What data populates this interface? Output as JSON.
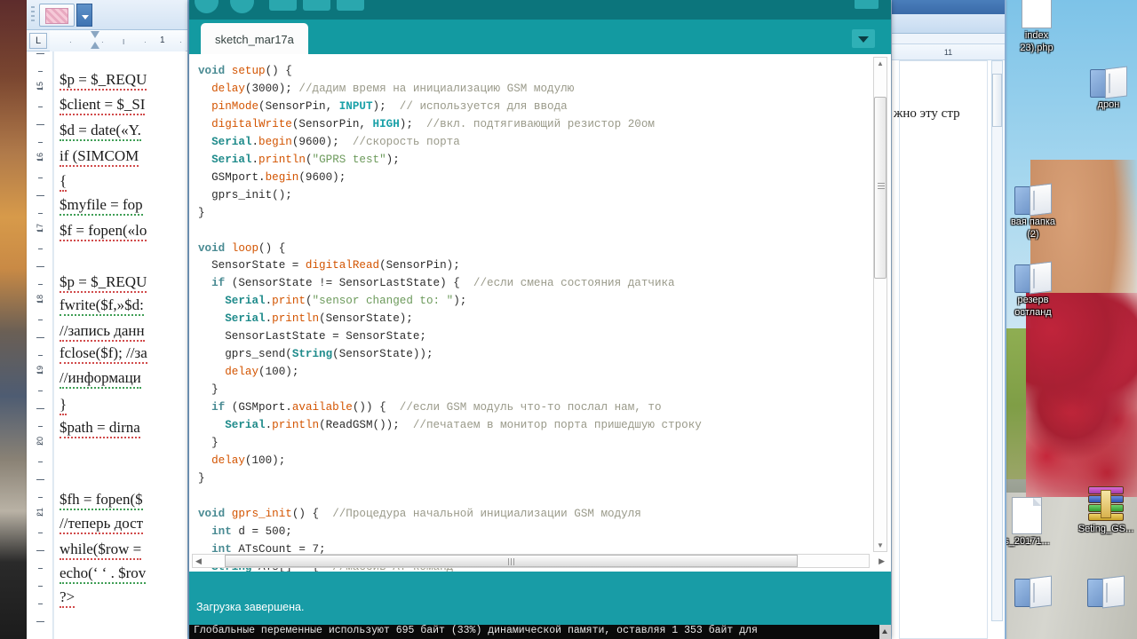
{
  "desktop": {
    "icons": [
      {
        "name": "index(23).php",
        "label_line1": "index",
        "label_line2": "23).php",
        "type": "doc"
      },
      {
        "name": "дрон",
        "label_line1": "дрон",
        "label_line2": "",
        "type": "folder"
      },
      {
        "name": "Новая папка (2)",
        "label_line1": "вая папка",
        "label_line2": "(2)",
        "type": "folder"
      },
      {
        "name": "резерв Хостланд",
        "label_line1": "резерв",
        "label_line2": "остланд",
        "type": "folder"
      },
      {
        "name": "s_20171...",
        "label_line1": "s_20171...",
        "label_line2": "",
        "type": "doc"
      },
      {
        "name": "Seting_GS...",
        "label_line1": "Seting_GS...",
        "label_line2": "",
        "type": "rar",
        "rar_letter": "R"
      }
    ]
  },
  "word_front": {
    "ruler": {
      "tab_selector": "L",
      "marks": [
        "·",
        "·",
        "I",
        "·",
        "1",
        "·"
      ]
    },
    "line_numbers": [
      "15",
      "16",
      "17",
      "18",
      "19",
      "20",
      "21"
    ],
    "lines": [
      "$p = $_REQU",
      "$client = $_SI",
      "$d = date(«Y.",
      "if (SIMCOM",
      "{",
      "$myfile = fop",
      "$f = fopen(«lo",
      "$p = $_REQU",
      "fwrite($f,»$d:",
      "//запись данн",
      "fclose($f); //за",
      "//информаци",
      "}",
      "$path = dirna",
      "$fh = fopen($",
      "//теперь дост",
      "while($row =",
      "echo(‘ ‘ . $rov",
      "?>"
    ]
  },
  "word_back": {
    "ruler_number": "11",
    "visible_text": "жно эту стр"
  },
  "arduino": {
    "tab_label": "sketch_mar17a",
    "tab_menu_icon": "chevron-down-icon",
    "status_message": "Загрузка завершена.",
    "console_message": "Глобальные переменные используют 695 байт (33%) динамической памяти, оставляя 1 353 байт для",
    "code_lines": [
      [
        {
          "t": "void ",
          "c": "kw"
        },
        {
          "t": "setup",
          "c": "fn"
        },
        {
          "t": "() {",
          "c": ""
        }
      ],
      [
        {
          "t": "  ",
          "c": ""
        },
        {
          "t": "delay",
          "c": "fn"
        },
        {
          "t": "(3000); ",
          "c": ""
        },
        {
          "t": "//дадим время на инициализацию GSM модулю",
          "c": "cmt"
        }
      ],
      [
        {
          "t": "  ",
          "c": ""
        },
        {
          "t": "pinMode",
          "c": "fn"
        },
        {
          "t": "(SensorPin, ",
          "c": ""
        },
        {
          "t": "INPUT",
          "c": "cnst"
        },
        {
          "t": ");  ",
          "c": ""
        },
        {
          "t": "// используется для ввода",
          "c": "cmt"
        }
      ],
      [
        {
          "t": "  ",
          "c": ""
        },
        {
          "t": "digitalWrite",
          "c": "fn"
        },
        {
          "t": "(SensorPin, ",
          "c": ""
        },
        {
          "t": "HIGH",
          "c": "cnst"
        },
        {
          "t": ");  ",
          "c": ""
        },
        {
          "t": "//вкл. подтягивающий резистор 20ом",
          "c": "cmt"
        }
      ],
      [
        {
          "t": "  ",
          "c": ""
        },
        {
          "t": "Serial",
          "c": "cls"
        },
        {
          "t": ".",
          "c": ""
        },
        {
          "t": "begin",
          "c": "fn"
        },
        {
          "t": "(9600);  ",
          "c": ""
        },
        {
          "t": "//скорость порта",
          "c": "cmt"
        }
      ],
      [
        {
          "t": "  ",
          "c": ""
        },
        {
          "t": "Serial",
          "c": "cls"
        },
        {
          "t": ".",
          "c": ""
        },
        {
          "t": "println",
          "c": "fn"
        },
        {
          "t": "(",
          "c": ""
        },
        {
          "t": "\"GPRS test\"",
          "c": "str"
        },
        {
          "t": ");",
          "c": ""
        }
      ],
      [
        {
          "t": "  GSMport.",
          "c": ""
        },
        {
          "t": "begin",
          "c": "fn"
        },
        {
          "t": "(9600);",
          "c": ""
        }
      ],
      [
        {
          "t": "  gprs_init();",
          "c": ""
        }
      ],
      [
        {
          "t": "}",
          "c": ""
        }
      ],
      [
        {
          "t": "",
          "c": ""
        }
      ],
      [
        {
          "t": "void ",
          "c": "kw"
        },
        {
          "t": "loop",
          "c": "fn"
        },
        {
          "t": "() {",
          "c": ""
        }
      ],
      [
        {
          "t": "  SensorState = ",
          "c": ""
        },
        {
          "t": "digitalRead",
          "c": "fn"
        },
        {
          "t": "(SensorPin);",
          "c": ""
        }
      ],
      [
        {
          "t": "  ",
          "c": ""
        },
        {
          "t": "if",
          "c": "kw"
        },
        {
          "t": " (SensorState != SensorLastState) {  ",
          "c": ""
        },
        {
          "t": "//если смена состояния датчика",
          "c": "cmt"
        }
      ],
      [
        {
          "t": "    ",
          "c": ""
        },
        {
          "t": "Serial",
          "c": "cls"
        },
        {
          "t": ".",
          "c": ""
        },
        {
          "t": "print",
          "c": "fn"
        },
        {
          "t": "(",
          "c": ""
        },
        {
          "t": "\"sensor changed to: \"",
          "c": "str"
        },
        {
          "t": ");",
          "c": ""
        }
      ],
      [
        {
          "t": "    ",
          "c": ""
        },
        {
          "t": "Serial",
          "c": "cls"
        },
        {
          "t": ".",
          "c": ""
        },
        {
          "t": "println",
          "c": "fn"
        },
        {
          "t": "(SensorState);",
          "c": ""
        }
      ],
      [
        {
          "t": "    SensorLastState = SensorState;",
          "c": ""
        }
      ],
      [
        {
          "t": "    gprs_send(",
          "c": ""
        },
        {
          "t": "String",
          "c": "cls"
        },
        {
          "t": "(SensorState));",
          "c": ""
        }
      ],
      [
        {
          "t": "    ",
          "c": ""
        },
        {
          "t": "delay",
          "c": "fn"
        },
        {
          "t": "(100);",
          "c": ""
        }
      ],
      [
        {
          "t": "  }",
          "c": ""
        }
      ],
      [
        {
          "t": "  ",
          "c": ""
        },
        {
          "t": "if",
          "c": "kw"
        },
        {
          "t": " (GSMport.",
          "c": ""
        },
        {
          "t": "available",
          "c": "fn"
        },
        {
          "t": "()) {  ",
          "c": ""
        },
        {
          "t": "//если GSM модуль что-то послал нам, то",
          "c": "cmt"
        }
      ],
      [
        {
          "t": "    ",
          "c": ""
        },
        {
          "t": "Serial",
          "c": "cls"
        },
        {
          "t": ".",
          "c": ""
        },
        {
          "t": "println",
          "c": "fn"
        },
        {
          "t": "(ReadGSM());  ",
          "c": ""
        },
        {
          "t": "//печатаем в монитор порта пришедшую строку",
          "c": "cmt"
        }
      ],
      [
        {
          "t": "  }",
          "c": ""
        }
      ],
      [
        {
          "t": "  ",
          "c": ""
        },
        {
          "t": "delay",
          "c": "fn"
        },
        {
          "t": "(100);",
          "c": ""
        }
      ],
      [
        {
          "t": "}",
          "c": ""
        }
      ],
      [
        {
          "t": "",
          "c": ""
        }
      ],
      [
        {
          "t": "void ",
          "c": "kw"
        },
        {
          "t": "gprs_init",
          "c": "fn"
        },
        {
          "t": "() {  ",
          "c": ""
        },
        {
          "t": "//Процедура начальной инициализации GSM модуля",
          "c": "cmt"
        }
      ],
      [
        {
          "t": "  ",
          "c": ""
        },
        {
          "t": "int",
          "c": "kw"
        },
        {
          "t": " d = 500;",
          "c": ""
        }
      ],
      [
        {
          "t": "  ",
          "c": ""
        },
        {
          "t": "int",
          "c": "kw"
        },
        {
          "t": " ATsCount = 7;",
          "c": ""
        }
      ],
      [
        {
          "t": "  ",
          "c": ""
        },
        {
          "t": "String",
          "c": "cls"
        },
        {
          "t": " ATs[] = {  ",
          "c": ""
        },
        {
          "t": "//массив AT команд",
          "c": "cmt"
        }
      ]
    ]
  },
  "colors": {
    "arduino_teal": "#189ca6",
    "arduino_toolbar": "#0c757c",
    "arduino_tabbar": "#139aa1",
    "console_bg": "#0a0a0a",
    "word_chrome": "#d4e4f4"
  }
}
